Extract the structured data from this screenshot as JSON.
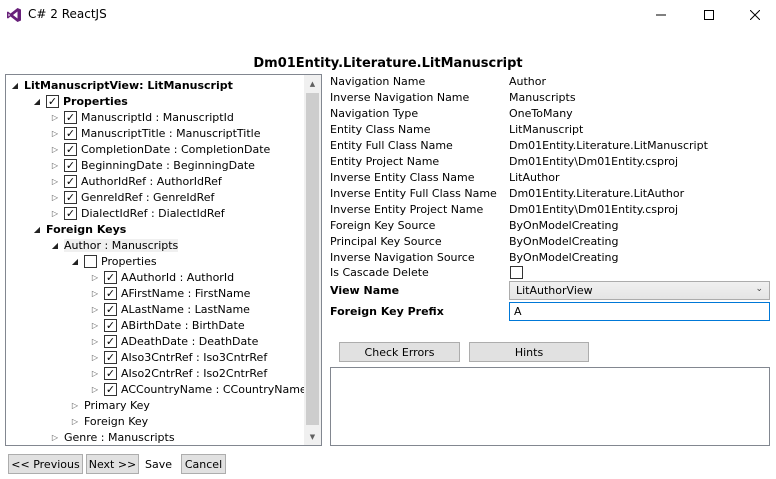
{
  "window": {
    "title": "C# 2 ReactJS",
    "icon": "visual-studio-icon",
    "accent": "#68217a"
  },
  "header": {
    "title": "Dm01Entity.Literature.LitManuscript"
  },
  "tree": {
    "root": "LitManuscriptView: LitManuscript",
    "properties_label": "Properties",
    "properties": [
      "ManuscriptId : ManuscriptId",
      "ManuscriptTitle : ManuscriptTitle",
      "CompletionDate : CompletionDate",
      "BeginningDate : BeginningDate",
      "AuthorIdRef : AuthorIdRef",
      "GenreIdRef : GenreIdRef",
      "DialectIdRef : DialectIdRef"
    ],
    "foreign_keys_label": "Foreign Keys",
    "fk_author": "Author : Manuscripts",
    "fk_author_properties_label": "Properties",
    "fk_author_properties": [
      "AAuthorId : AuthorId",
      "AFirstName : FirstName",
      "ALastName : LastName",
      "ABirthDate : BirthDate",
      "ADeathDate : DeathDate",
      "AIso3CntrRef : Iso3CntrRef",
      "AIso2CntrRef : Iso2CntrRef",
      "ACCountryName : CCountryName"
    ],
    "primary_key_label": "Primary Key",
    "foreign_key_label": "Foreign Key",
    "fk_genre": "Genre : Manuscripts"
  },
  "props": [
    {
      "name": "Navigation Name",
      "value": "Author"
    },
    {
      "name": "Inverse Navigation Name",
      "value": "Manuscripts"
    },
    {
      "name": "Navigation Type",
      "value": "OneToMany"
    },
    {
      "name": "Entity Class Name",
      "value": "LitManuscript"
    },
    {
      "name": "Entity Full Class Name",
      "value": "Dm01Entity.Literature.LitManuscript"
    },
    {
      "name": "Entity Project Name",
      "value": "Dm01Entity\\Dm01Entity.csproj"
    },
    {
      "name": "Inverse Entity Class Name",
      "value": "LitAuthor"
    },
    {
      "name": "Inverse Entity Full Class Name",
      "value": "Dm01Entity.Literature.LitAuthor"
    },
    {
      "name": "Inverse Entity Project Name",
      "value": "Dm01Entity\\Dm01Entity.csproj"
    },
    {
      "name": "Foreign Key Source",
      "value": "ByOnModelCreating"
    },
    {
      "name": "Principal Key Source",
      "value": "ByOnModelCreating"
    },
    {
      "name": "Inverse Navigation Source",
      "value": "ByOnModelCreating"
    }
  ],
  "cascade": {
    "label": "Is Cascade Delete",
    "checked": false
  },
  "view_name": {
    "label": "View Name",
    "selected": "LitAuthorView"
  },
  "fk_prefix": {
    "label": "Foreign Key Prefix",
    "value": "A"
  },
  "buttons": {
    "check_errors": "Check Errors",
    "hints": "Hints",
    "previous": "<< Previous",
    "next": "Next >>",
    "save": "Save",
    "cancel": "Cancel"
  }
}
